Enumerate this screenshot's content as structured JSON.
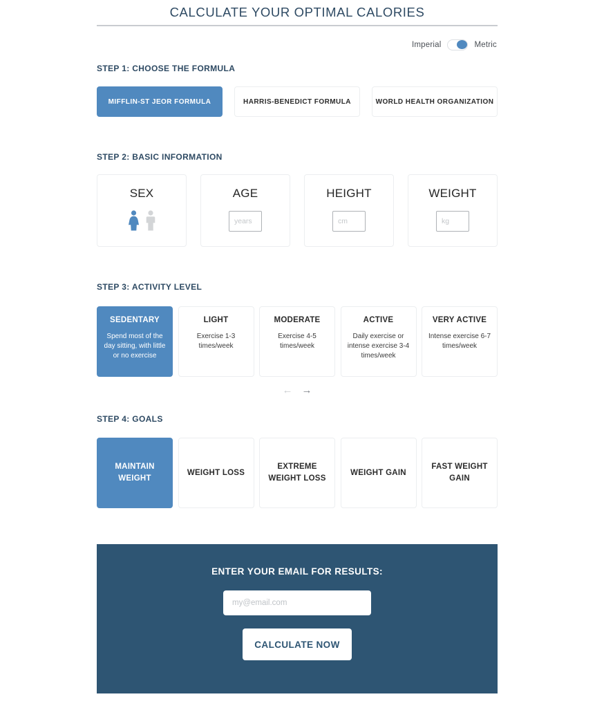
{
  "header": {
    "title": "CALCULATE YOUR OPTIMAL CALORIES"
  },
  "units": {
    "left_label": "Imperial",
    "right_label": "Metric",
    "selected": "Metric"
  },
  "step1": {
    "heading": "STEP 1: CHOOSE THE FORMULA",
    "options": [
      {
        "label": "MIFFLIN-ST JEOR FORMULA",
        "selected": true
      },
      {
        "label": "HARRIS-BENEDICT FORMULA",
        "selected": false
      },
      {
        "label": "WORLD HEALTH ORGANIZATION",
        "selected": false
      }
    ]
  },
  "step2": {
    "heading": "STEP 2: BASIC INFORMATION",
    "sex": {
      "title": "SEX",
      "female_icon": "female-figure-icon",
      "male_icon": "male-figure-icon",
      "selected": "female"
    },
    "age": {
      "title": "AGE",
      "placeholder": "years",
      "value": ""
    },
    "height": {
      "title": "HEIGHT",
      "placeholder": "cm",
      "value": ""
    },
    "weight": {
      "title": "WEIGHT",
      "placeholder": "kg",
      "value": ""
    }
  },
  "step3": {
    "heading": "STEP 3: ACTIVITY LEVEL",
    "options": [
      {
        "name": "SEDENTARY",
        "desc": "Spend most of the day sitting, with little or no exercise",
        "selected": true
      },
      {
        "name": "LIGHT",
        "desc": "Exercise 1-3 times/week",
        "selected": false
      },
      {
        "name": "MODERATE",
        "desc": "Exercise 4-5 times/week",
        "selected": false
      },
      {
        "name": "ACTIVE",
        "desc": "Daily exercise or intense exercise 3-4 times/week",
        "selected": false
      },
      {
        "name": "VERY ACTIVE",
        "desc": "Intense exercise 6-7 times/week",
        "selected": false
      }
    ],
    "prev_arrow": "←",
    "next_arrow": "→"
  },
  "step4": {
    "heading": "STEP 4: GOALS",
    "options": [
      {
        "label": "MAINTAIN WEIGHT",
        "selected": true
      },
      {
        "label": "WEIGHT LOSS",
        "selected": false
      },
      {
        "label": "EXTREME WEIGHT LOSS",
        "selected": false
      },
      {
        "label": "WEIGHT GAIN",
        "selected": false
      },
      {
        "label": "FAST WEIGHT GAIN",
        "selected": false
      }
    ]
  },
  "email_panel": {
    "heading": "ENTER YOUR EMAIL FOR RESULTS:",
    "placeholder": "my@email.com",
    "value": "",
    "button_label": "CALCULATE NOW"
  },
  "colors": {
    "accent": "#5089bf",
    "panel": "#2e5573",
    "heading": "#2e4a63",
    "card_border": "#eceef0",
    "muted": "#c9ccd0"
  }
}
